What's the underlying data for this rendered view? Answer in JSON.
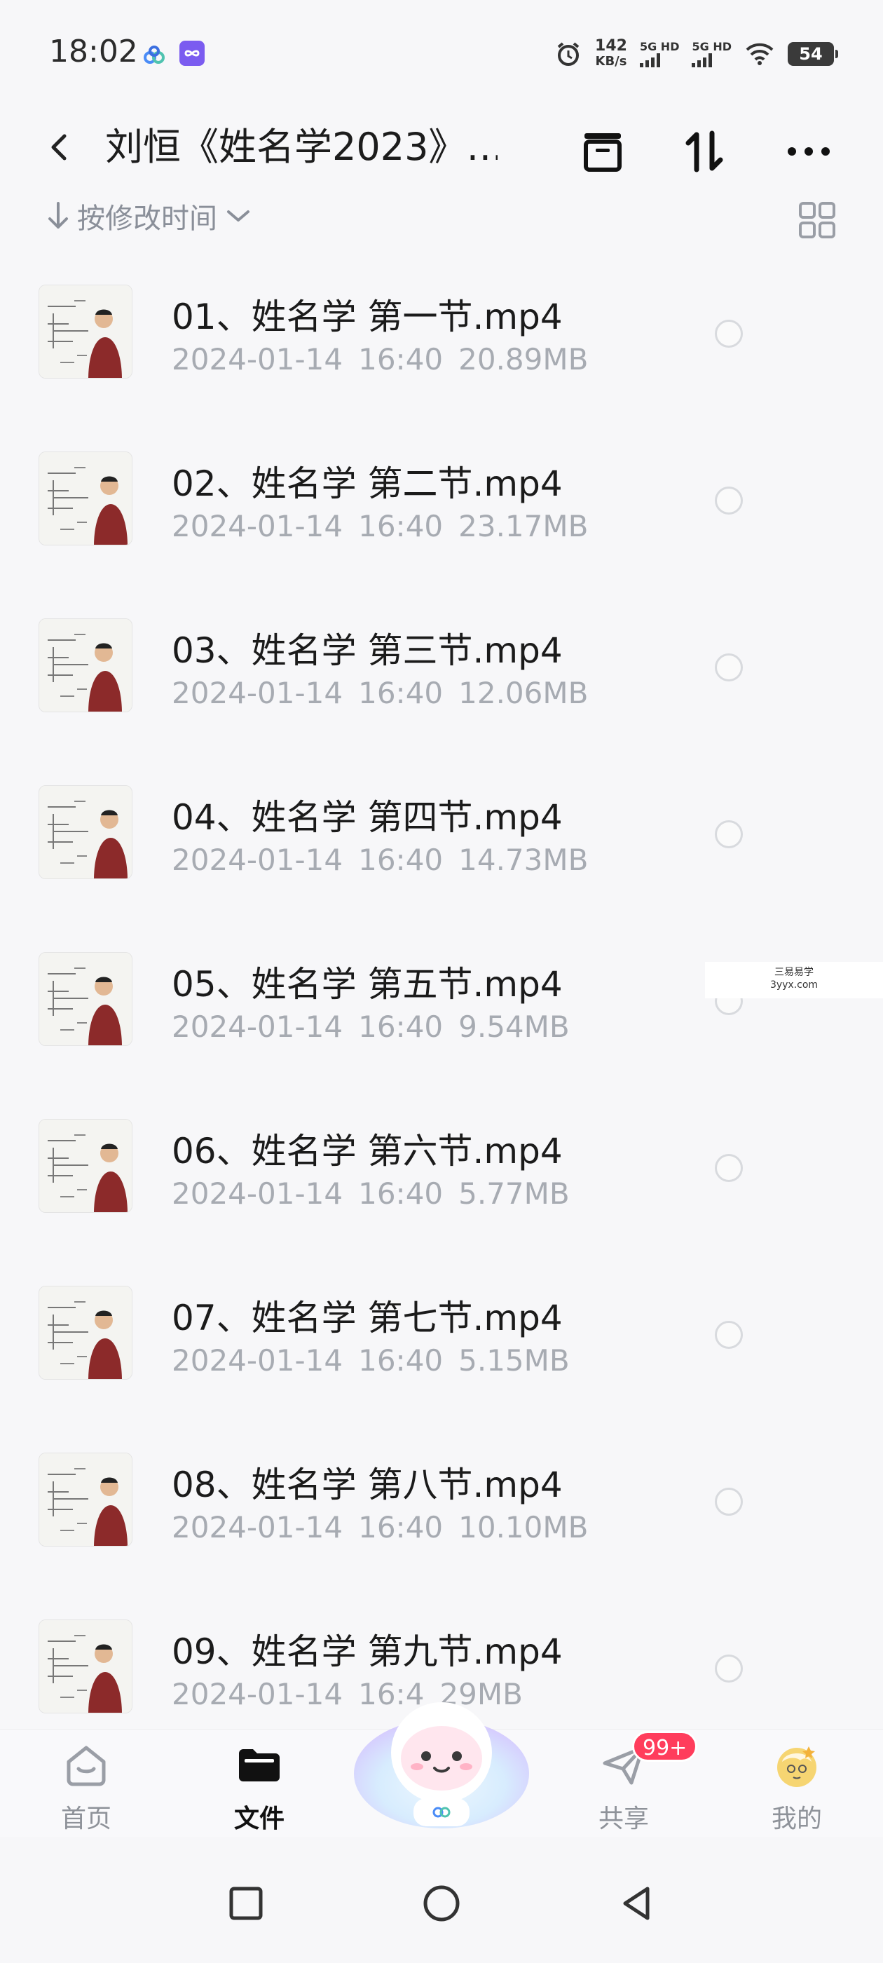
{
  "status_bar": {
    "time": "18:02",
    "speed_value": "142",
    "speed_unit": "KB/s",
    "sim1": "5G HD",
    "sim2": "5G HD",
    "battery": "54"
  },
  "header": {
    "title": "刘恒《姓名学2023》…"
  },
  "sort": {
    "label": "按修改时间"
  },
  "files": [
    {
      "name": "01、姓名学 第一节.mp4",
      "date": "2024-01-14",
      "time": "16:40",
      "size": "20.89MB"
    },
    {
      "name": "02、姓名学 第二节.mp4",
      "date": "2024-01-14",
      "time": "16:40",
      "size": "23.17MB"
    },
    {
      "name": "03、姓名学 第三节.mp4",
      "date": "2024-01-14",
      "time": "16:40",
      "size": "12.06MB"
    },
    {
      "name": "04、姓名学 第四节.mp4",
      "date": "2024-01-14",
      "time": "16:40",
      "size": "14.73MB"
    },
    {
      "name": "05、姓名学 第五节.mp4",
      "date": "2024-01-14",
      "time": "16:40",
      "size": "9.54MB"
    },
    {
      "name": "06、姓名学 第六节.mp4",
      "date": "2024-01-14",
      "time": "16:40",
      "size": "5.77MB"
    },
    {
      "name": "07、姓名学 第七节.mp4",
      "date": "2024-01-14",
      "time": "16:40",
      "size": "5.15MB"
    },
    {
      "name": "08、姓名学 第八节.mp4",
      "date": "2024-01-14",
      "time": "16:40",
      "size": "10.10MB"
    },
    {
      "name": "09、姓名学 第九节.mp4",
      "date": "2024-01-14",
      "time": "16:4",
      "size": "29MB"
    }
  ],
  "watermark": {
    "line1": "三易易学",
    "line2": "3yyx.com"
  },
  "bottom_nav": {
    "items": [
      {
        "label": "首页",
        "icon": "home-icon"
      },
      {
        "label": "文件",
        "icon": "folder-icon"
      },
      {
        "label": "共享",
        "icon": "send-icon"
      },
      {
        "label": "我的",
        "icon": "avatar"
      }
    ],
    "share_badge": "99+"
  },
  "colors": {
    "accent_badge": "#ff3d5c",
    "meta_text": "#a7abb2",
    "background": "#f7f7f9"
  }
}
